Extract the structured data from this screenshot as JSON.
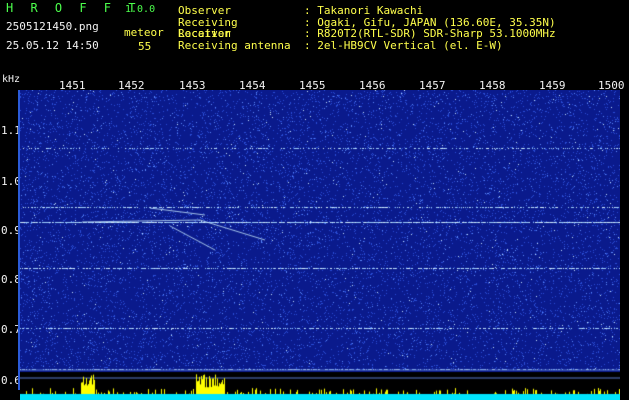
{
  "header": {
    "logo": "H R O F F T",
    "version": "1.0.0",
    "filename": "2505121450.png",
    "datetime": "25.05.12 14:50",
    "mode": "meteor",
    "count": "55",
    "info": [
      {
        "label": "Observer",
        "value": ": Takanori Kawachi"
      },
      {
        "label": "Receiving Location",
        "value": ": Ogaki, Gifu, JAPAN (136.60E, 35.35N)"
      },
      {
        "label": "Receiver",
        "value": ": R820T2(RTL-SDR) SDR-Sharp 53.1000MHz"
      },
      {
        "label": "Receiving antenna",
        "value": ": 2el-HB9CV Vertical (el. E-W)"
      }
    ]
  },
  "spectrogram": {
    "unit": "kHz",
    "time_ticks": [
      "1451",
      "1452",
      "1453",
      "1454",
      "1455",
      "1456",
      "1457",
      "1458",
      "1459",
      "1500"
    ],
    "freq_ticks": [
      "1.1",
      "1.0",
      "0.9",
      "0.8",
      "0.7",
      "0.6"
    ],
    "colors": {
      "background": "#0a1a8c",
      "noise": "#3a6cff",
      "line": "#9fd0ff",
      "bar": "#ffff00",
      "baseline": "#00e5ff"
    }
  }
}
